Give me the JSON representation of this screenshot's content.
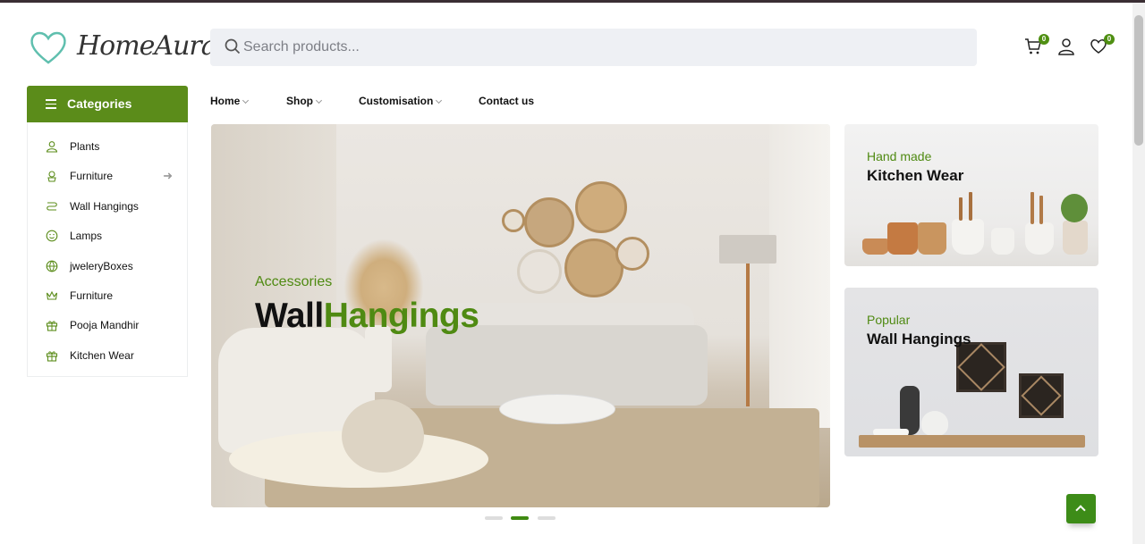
{
  "brand": {
    "logo_text": "HomeAura"
  },
  "search": {
    "placeholder": "Search products..."
  },
  "header_icons": {
    "cart_count": "0",
    "wishlist_count": "0"
  },
  "categories": {
    "title": "Categories",
    "items": [
      {
        "label": "Plants",
        "icon": "person-icon"
      },
      {
        "label": "Furniture",
        "icon": "plant-icon",
        "has_submenu": true
      },
      {
        "label": "Wall Hangings",
        "icon": "hanger-icon"
      },
      {
        "label": "Lamps",
        "icon": "smile-icon"
      },
      {
        "label": "jweleryBoxes",
        "icon": "globe-icon"
      },
      {
        "label": "Furniture",
        "icon": "crown-icon"
      },
      {
        "label": "Pooja Mandhir",
        "icon": "gift-icon"
      },
      {
        "label": "Kitchen Wear",
        "icon": "gift-icon"
      }
    ]
  },
  "nav": {
    "items": [
      {
        "label": "Home"
      },
      {
        "label": "Shop"
      },
      {
        "label": "Customisation"
      },
      {
        "label": "Contact us"
      }
    ]
  },
  "hero": {
    "subtitle": "Accessories",
    "title_part1": "Wall",
    "title_part2": "Hangings",
    "slide_count": 3,
    "active_slide": 2
  },
  "side_banners": [
    {
      "subtitle": "Hand made",
      "title": "Kitchen Wear"
    },
    {
      "subtitle": "Popular",
      "title": "Wall Hangings"
    }
  ],
  "colors": {
    "accent": "#5b8c1a",
    "accent_text": "#4f8a12"
  }
}
